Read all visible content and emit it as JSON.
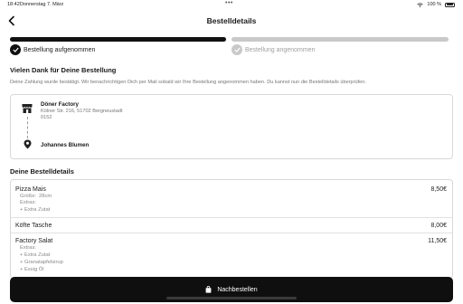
{
  "status_bar": {
    "time": "18:42",
    "date": "Donnerstag 7. März",
    "dots": "•••",
    "battery": "100 %"
  },
  "header": {
    "title": "Bestelldetails",
    "back_icon": "chevron-left-icon"
  },
  "progress": {
    "steps": [
      {
        "label": "Bestellung aufgenommen",
        "done": true
      },
      {
        "label": "Bestellung angenommen",
        "done": false
      }
    ]
  },
  "thanks": {
    "title": "Vielen Dank für Deine Bestellung",
    "text": "Deine Zahlung wurde bestätigt. Wir benachrichtigen Dich per Mail sobald wir Ihre Bestellung angenommen haben. Du kannst nun die Bestelldetails überprüfen."
  },
  "address": {
    "shop_name": "Döner Factory",
    "shop_street": "Kölner Str. 216, 51702 Bergneustadt",
    "shop_zip": "0152",
    "recipient": "Johannes Blumen"
  },
  "details": {
    "title": "Deine Bestelldetails",
    "items": [
      {
        "name": "Pizza Mais",
        "price": "8,50€",
        "size_label": "Größe:",
        "size_value": "28cm",
        "extras_label": "Extras:",
        "extras": [
          "+ Extra Zutat"
        ]
      },
      {
        "name": "Köfte Tasche",
        "price": "8,00€"
      },
      {
        "name": "Factory Salat",
        "price": "11,50€",
        "extras_label": "Extras:",
        "extras": [
          "+ Extra Zutat",
          "+ Granatapfelsirup",
          "+ Essig Öl"
        ]
      }
    ]
  },
  "cta": {
    "label": "Nachbestellen"
  },
  "colors": {
    "primary": "#0f0f0f",
    "inactive": "#c9c9c9",
    "muted_text": "#777777"
  }
}
